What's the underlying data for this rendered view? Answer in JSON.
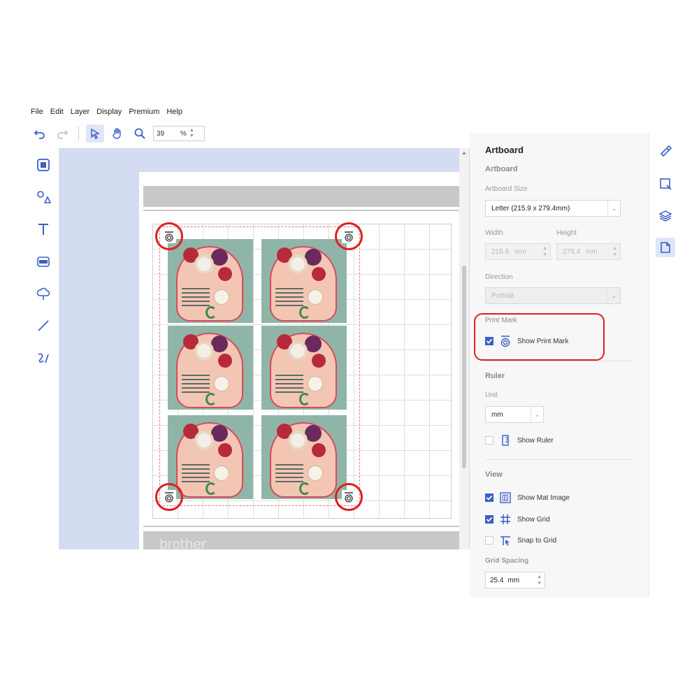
{
  "menu": [
    "File",
    "Edit",
    "Layer",
    "Display",
    "Premium",
    "Help"
  ],
  "toolbar": {
    "zoom_value": "39",
    "zoom_unit": "%"
  },
  "canvas": {
    "brand": "brother"
  },
  "panel": {
    "title": "Artboard",
    "artboard_section": "Artboard",
    "artboard_size_label": "Artboard Size",
    "artboard_size_value": "Letter (215.9 x 279.4mm)",
    "width_label": "Width",
    "height_label": "Height",
    "width_value": "215.9",
    "height_value": "279.4",
    "width_unit": "mm",
    "height_unit": "mm",
    "direction_label": "Direction",
    "direction_value": "Portrait",
    "print_mark_label": "Print Mark",
    "show_print_mark": "Show Print Mark",
    "ruler_section": "Ruler",
    "unit_label": "Unit",
    "unit_value": "mm",
    "show_ruler": "Show Ruler",
    "view_section": "View",
    "show_mat_image": "Show Mat Image",
    "show_grid": "Show Grid",
    "snap_to_grid": "Snap to Grid",
    "grid_spacing_label": "Grid Spacing",
    "grid_spacing_value": "25.4",
    "grid_spacing_unit": "mm"
  },
  "checks": {
    "show_print_mark": true,
    "show_ruler": false,
    "show_mat_image": true,
    "show_grid": true,
    "snap_to_grid": false
  },
  "colors": {
    "accent": "#3b5ec7",
    "highlight": "#e01e1e",
    "canvas_bg": "#d3dcf0"
  }
}
